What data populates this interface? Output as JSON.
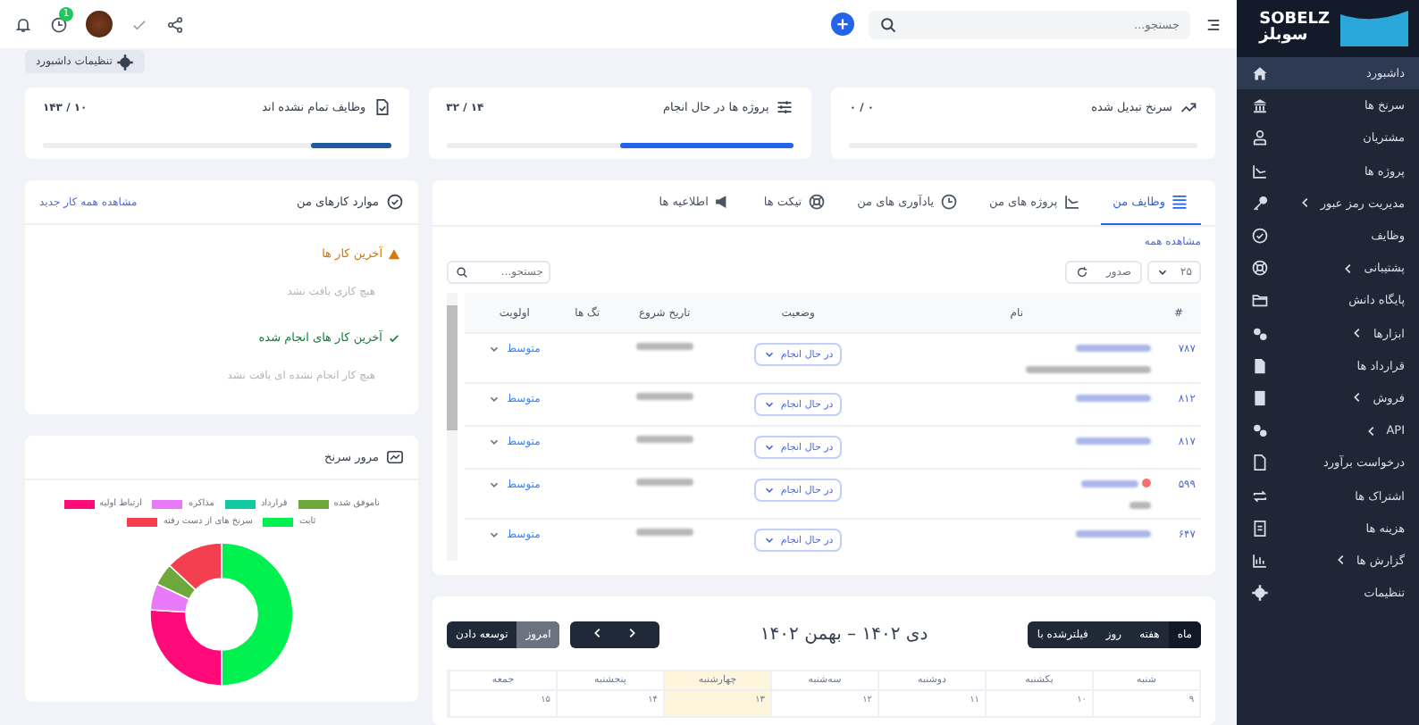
{
  "sidebar": {
    "logo_latin": "SOBELZ",
    "logo_persian": "سوبلز",
    "items": [
      {
        "label": "داشبورد",
        "selected": true,
        "expandable": false
      },
      {
        "label": "سرنخ ها",
        "selected": false,
        "expandable": false
      },
      {
        "label": "مشتریان",
        "selected": false,
        "expandable": false
      },
      {
        "label": "پروژه ها",
        "selected": false,
        "expandable": false
      },
      {
        "label": "مدیریت رمز عبور",
        "selected": false,
        "expandable": true
      },
      {
        "label": "وظایف",
        "selected": false,
        "expandable": false
      },
      {
        "label": "پشتیبانی",
        "selected": false,
        "expandable": true
      },
      {
        "label": "پایگاه دانش",
        "selected": false,
        "expandable": false
      },
      {
        "label": "ابزارها",
        "selected": false,
        "expandable": true
      },
      {
        "label": "قرارداد ها",
        "selected": false,
        "expandable": false
      },
      {
        "label": "فروش",
        "selected": false,
        "expandable": true
      },
      {
        "label": "API",
        "selected": false,
        "expandable": true
      },
      {
        "label": "درخواست برآورد",
        "selected": false,
        "expandable": false
      },
      {
        "label": "اشتراک ها",
        "selected": false,
        "expandable": false
      },
      {
        "label": "هزینه ها",
        "selected": false,
        "expandable": false
      },
      {
        "label": "گزارش ها",
        "selected": false,
        "expandable": true
      },
      {
        "label": "تنظیمات",
        "selected": false,
        "expandable": false
      }
    ]
  },
  "topbar": {
    "search": {
      "placeholder": "جستجو..."
    },
    "badge": "1"
  },
  "dashboard_settings": "تنظیمات داشبورد",
  "stats": [
    {
      "title": "سرنخ تبدیل شده",
      "value": "۰ / ۰",
      "level": 0
    },
    {
      "title": "پروژه ها در حال انجام",
      "value": "۱۴ / ۳۲",
      "level": 0.5
    },
    {
      "title": "وظایف تمام نشده اند",
      "value": "۱۰ / ۱۴۳",
      "level": 0.23
    }
  ],
  "tasks_panel": {
    "tabs": [
      {
        "label": "وظایف من",
        "selected": true
      },
      {
        "label": "پروژه های من",
        "selected": false
      },
      {
        "label": "یادآوری های من",
        "selected": false
      },
      {
        "label": "تیکت ها",
        "selected": false
      },
      {
        "label": "اطلاعیه ها",
        "selected": false
      }
    ],
    "view_all": "مشاهده همه",
    "page_size": "۲۵",
    "export": "صدور",
    "search": {
      "placeholder": "جستجو..."
    },
    "table": {
      "columns": [
        "#",
        "نام",
        "وضعیت",
        "تاریخ شروع",
        "تگ ها",
        "اولویت"
      ],
      "rows": [
        {
          "id": "۷۸۷",
          "details": true,
          "flag": false,
          "status": "در حال انجام",
          "priority": "متوسط"
        },
        {
          "id": "۸۱۲",
          "details": false,
          "flag": false,
          "status": "در حال انجام",
          "priority": "متوسط"
        },
        {
          "id": "۸۱۷",
          "details": false,
          "flag": false,
          "status": "در حال انجام",
          "priority": "متوسط"
        },
        {
          "id": "۵۹۹",
          "details": true,
          "flag": true,
          "status": "در حال انجام",
          "priority": "متوسط"
        },
        {
          "id": "۶۴۷",
          "details": false,
          "flag": false,
          "status": "در حال انجام",
          "priority": "متوسط"
        }
      ]
    }
  },
  "calendar": {
    "views": [
      {
        "label": "ماه",
        "selected": true
      },
      {
        "label": "هفته",
        "selected": false
      },
      {
        "label": "روز",
        "selected": false
      },
      {
        "label": "فیلترشده با",
        "selected": false
      }
    ],
    "title": "دی ۱۴۰۲ – بهمن ۱۴۰۲",
    "today": "امروز",
    "expand": "توسعه دادن",
    "days": [
      {
        "name": "شنبه",
        "date": "۹",
        "today": false
      },
      {
        "name": "یکشنبه",
        "date": "۱۰",
        "today": false
      },
      {
        "name": "دوشنبه",
        "date": "۱۱",
        "today": false
      },
      {
        "name": "سه‌شنبه",
        "date": "۱۲",
        "today": false
      },
      {
        "name": "چهارشنبه",
        "date": "۱۳",
        "today": true
      },
      {
        "name": "پنجشنبه",
        "date": "۱۴",
        "today": false
      },
      {
        "name": "جمعه",
        "date": "۱۵",
        "today": false
      }
    ]
  },
  "my_todos": {
    "title": "موارد کارهای من",
    "link": "مشاهده همه کار جدید",
    "sections": [
      {
        "kind": "warning",
        "heading": "آخرین کار ها",
        "empty": "هیچ کاری یافت نشد"
      },
      {
        "kind": "done",
        "heading": "آخرین کار های انجام شده",
        "empty": "هیچ کار انجام نشده ای یافت نشد"
      }
    ]
  },
  "leads_overview": {
    "title": "مرور سرنخ",
    "legend": [
      {
        "label": "ناموفق شده",
        "color": "#6ea83a"
      },
      {
        "label": "قرارداد",
        "color": "#10c9a0"
      },
      {
        "label": "مذاکره",
        "color": "#e879f9"
      },
      {
        "label": "ارتباط اولیه",
        "color": "#ff0a78"
      },
      {
        "label": "ثابت",
        "color": "#00f050"
      },
      {
        "label": "سرنخ های از دست رفته",
        "color": "#f43f4e"
      }
    ]
  }
}
